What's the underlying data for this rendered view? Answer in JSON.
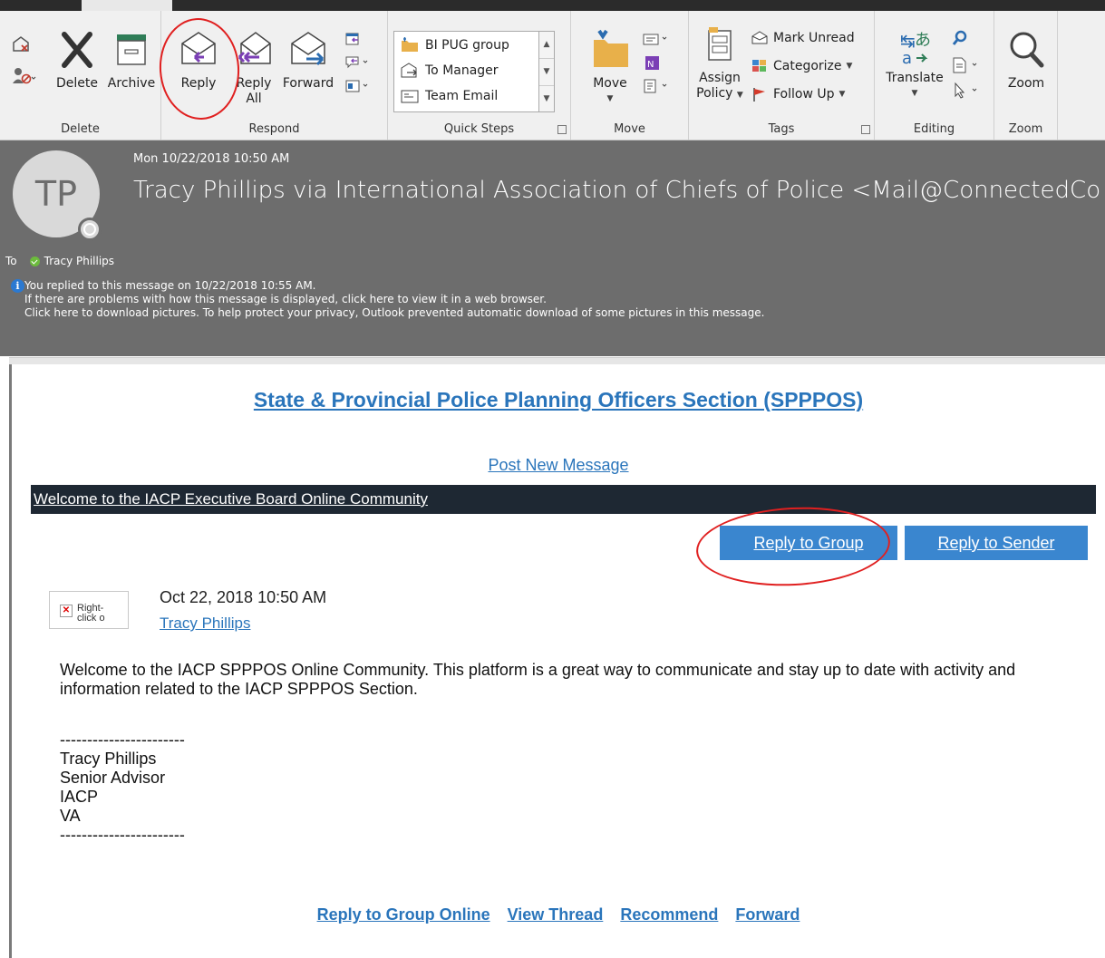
{
  "ribbon": {
    "groups": {
      "delete": "Delete",
      "respond": "Respond",
      "quick_steps": "Quick Steps",
      "move": "Move",
      "tags": "Tags",
      "editing": "Editing",
      "zoom": "Zoom"
    },
    "buttons": {
      "delete": "Delete",
      "archive": "Archive",
      "reply": "Reply",
      "reply_all_1": "Reply",
      "reply_all_2": "All",
      "forward": "Forward",
      "move": "Move",
      "assign_policy_1": "Assign",
      "assign_policy_2": "Policy",
      "translate": "Translate",
      "zoom": "Zoom"
    },
    "quick_steps": [
      "BI PUG group",
      "To Manager",
      "Team Email"
    ],
    "tags": {
      "mark_unread": "Mark Unread",
      "categorize": "Categorize",
      "follow_up": "Follow Up"
    }
  },
  "header": {
    "date": "Mon 10/22/2018 10:50 AM",
    "avatar_initials": "TP",
    "from": "Tracy Phillips via International Association of Chiefs of Police <Mail@ConnectedCo",
    "to_label": "To",
    "to_name": "Tracy Phillips",
    "info_lines": [
      "You replied to this message on 10/22/2018 10:55 AM.",
      "If there are problems with how this message is displayed, click here to view it in a web browser.",
      "Click here to download pictures. To help protect your privacy, Outlook prevented automatic download of some pictures in this message."
    ]
  },
  "body": {
    "section_title": "State & Provincial Police Planning Officers Section (SPPPOS)",
    "post_new_message": "Post New Message",
    "welcome_bar": "Welcome to the IACP Executive Board Online Community",
    "reply_to_group": "Reply to Group",
    "reply_to_sender": "Reply to Sender",
    "broken_image_text": "Right-click o",
    "post_date": "Oct 22, 2018 10:50 AM",
    "post_author": "Tracy Phillips",
    "post_text": "Welcome to the IACP SPPPOS Online Community. This platform is a great way to communicate and stay up to date with activity and information related to the IACP SPPPOS Section.",
    "signature": [
      "-----------------------",
      "Tracy Phillips",
      "Senior Advisor",
      "IACP",
      "VA",
      "-----------------------"
    ],
    "footer_links": [
      "Reply to Group Online",
      "View Thread",
      "Recommend",
      "Forward"
    ]
  },
  "colors": {
    "link_blue": "#2a75bb",
    "button_blue": "#3a86cf",
    "header_gray": "#6d6d6d",
    "annotation_red": "#e02020"
  }
}
